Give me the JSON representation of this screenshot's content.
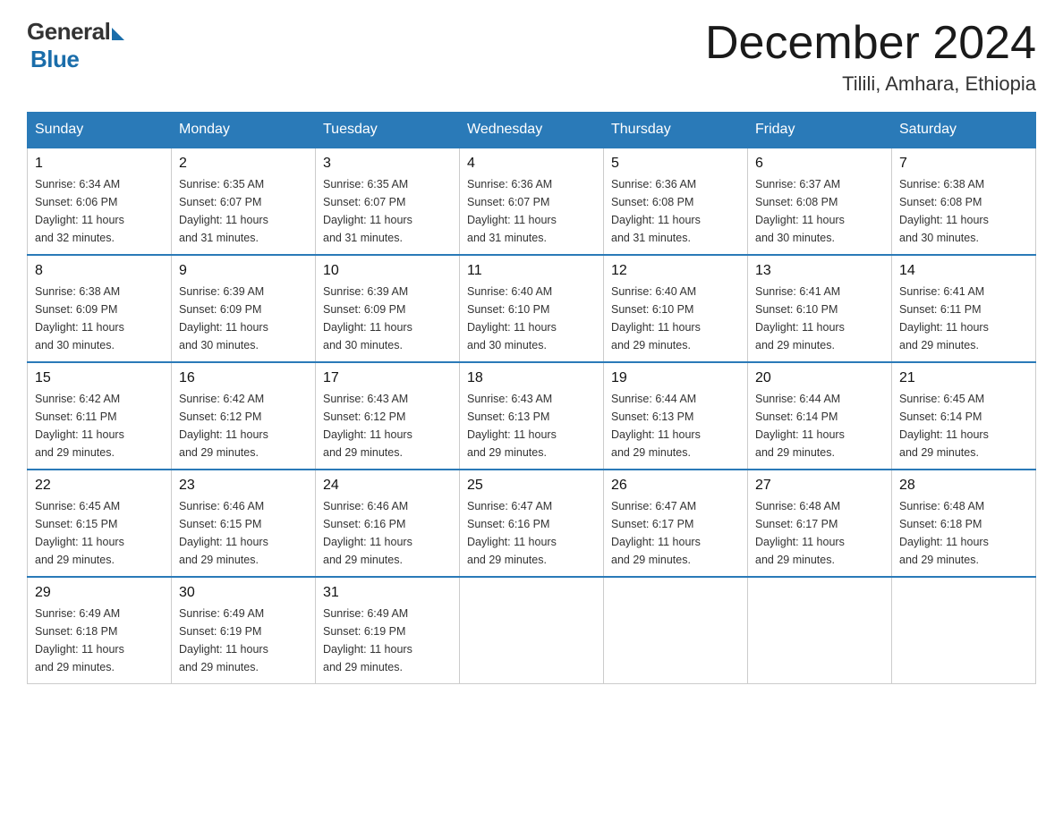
{
  "header": {
    "logo_general": "General",
    "logo_blue": "Blue",
    "month_title": "December 2024",
    "location": "Tilili, Amhara, Ethiopia"
  },
  "days_of_week": [
    "Sunday",
    "Monday",
    "Tuesday",
    "Wednesday",
    "Thursday",
    "Friday",
    "Saturday"
  ],
  "weeks": [
    [
      {
        "day": "1",
        "sunrise": "6:34 AM",
        "sunset": "6:06 PM",
        "daylight": "11 hours and 32 minutes."
      },
      {
        "day": "2",
        "sunrise": "6:35 AM",
        "sunset": "6:07 PM",
        "daylight": "11 hours and 31 minutes."
      },
      {
        "day": "3",
        "sunrise": "6:35 AM",
        "sunset": "6:07 PM",
        "daylight": "11 hours and 31 minutes."
      },
      {
        "day": "4",
        "sunrise": "6:36 AM",
        "sunset": "6:07 PM",
        "daylight": "11 hours and 31 minutes."
      },
      {
        "day": "5",
        "sunrise": "6:36 AM",
        "sunset": "6:08 PM",
        "daylight": "11 hours and 31 minutes."
      },
      {
        "day": "6",
        "sunrise": "6:37 AM",
        "sunset": "6:08 PM",
        "daylight": "11 hours and 30 minutes."
      },
      {
        "day": "7",
        "sunrise": "6:38 AM",
        "sunset": "6:08 PM",
        "daylight": "11 hours and 30 minutes."
      }
    ],
    [
      {
        "day": "8",
        "sunrise": "6:38 AM",
        "sunset": "6:09 PM",
        "daylight": "11 hours and 30 minutes."
      },
      {
        "day": "9",
        "sunrise": "6:39 AM",
        "sunset": "6:09 PM",
        "daylight": "11 hours and 30 minutes."
      },
      {
        "day": "10",
        "sunrise": "6:39 AM",
        "sunset": "6:09 PM",
        "daylight": "11 hours and 30 minutes."
      },
      {
        "day": "11",
        "sunrise": "6:40 AM",
        "sunset": "6:10 PM",
        "daylight": "11 hours and 30 minutes."
      },
      {
        "day": "12",
        "sunrise": "6:40 AM",
        "sunset": "6:10 PM",
        "daylight": "11 hours and 29 minutes."
      },
      {
        "day": "13",
        "sunrise": "6:41 AM",
        "sunset": "6:10 PM",
        "daylight": "11 hours and 29 minutes."
      },
      {
        "day": "14",
        "sunrise": "6:41 AM",
        "sunset": "6:11 PM",
        "daylight": "11 hours and 29 minutes."
      }
    ],
    [
      {
        "day": "15",
        "sunrise": "6:42 AM",
        "sunset": "6:11 PM",
        "daylight": "11 hours and 29 minutes."
      },
      {
        "day": "16",
        "sunrise": "6:42 AM",
        "sunset": "6:12 PM",
        "daylight": "11 hours and 29 minutes."
      },
      {
        "day": "17",
        "sunrise": "6:43 AM",
        "sunset": "6:12 PM",
        "daylight": "11 hours and 29 minutes."
      },
      {
        "day": "18",
        "sunrise": "6:43 AM",
        "sunset": "6:13 PM",
        "daylight": "11 hours and 29 minutes."
      },
      {
        "day": "19",
        "sunrise": "6:44 AM",
        "sunset": "6:13 PM",
        "daylight": "11 hours and 29 minutes."
      },
      {
        "day": "20",
        "sunrise": "6:44 AM",
        "sunset": "6:14 PM",
        "daylight": "11 hours and 29 minutes."
      },
      {
        "day": "21",
        "sunrise": "6:45 AM",
        "sunset": "6:14 PM",
        "daylight": "11 hours and 29 minutes."
      }
    ],
    [
      {
        "day": "22",
        "sunrise": "6:45 AM",
        "sunset": "6:15 PM",
        "daylight": "11 hours and 29 minutes."
      },
      {
        "day": "23",
        "sunrise": "6:46 AM",
        "sunset": "6:15 PM",
        "daylight": "11 hours and 29 minutes."
      },
      {
        "day": "24",
        "sunrise": "6:46 AM",
        "sunset": "6:16 PM",
        "daylight": "11 hours and 29 minutes."
      },
      {
        "day": "25",
        "sunrise": "6:47 AM",
        "sunset": "6:16 PM",
        "daylight": "11 hours and 29 minutes."
      },
      {
        "day": "26",
        "sunrise": "6:47 AM",
        "sunset": "6:17 PM",
        "daylight": "11 hours and 29 minutes."
      },
      {
        "day": "27",
        "sunrise": "6:48 AM",
        "sunset": "6:17 PM",
        "daylight": "11 hours and 29 minutes."
      },
      {
        "day": "28",
        "sunrise": "6:48 AM",
        "sunset": "6:18 PM",
        "daylight": "11 hours and 29 minutes."
      }
    ],
    [
      {
        "day": "29",
        "sunrise": "6:49 AM",
        "sunset": "6:18 PM",
        "daylight": "11 hours and 29 minutes."
      },
      {
        "day": "30",
        "sunrise": "6:49 AM",
        "sunset": "6:19 PM",
        "daylight": "11 hours and 29 minutes."
      },
      {
        "day": "31",
        "sunrise": "6:49 AM",
        "sunset": "6:19 PM",
        "daylight": "11 hours and 29 minutes."
      },
      null,
      null,
      null,
      null
    ]
  ],
  "labels": {
    "sunrise": "Sunrise:",
    "sunset": "Sunset:",
    "daylight": "Daylight:"
  }
}
